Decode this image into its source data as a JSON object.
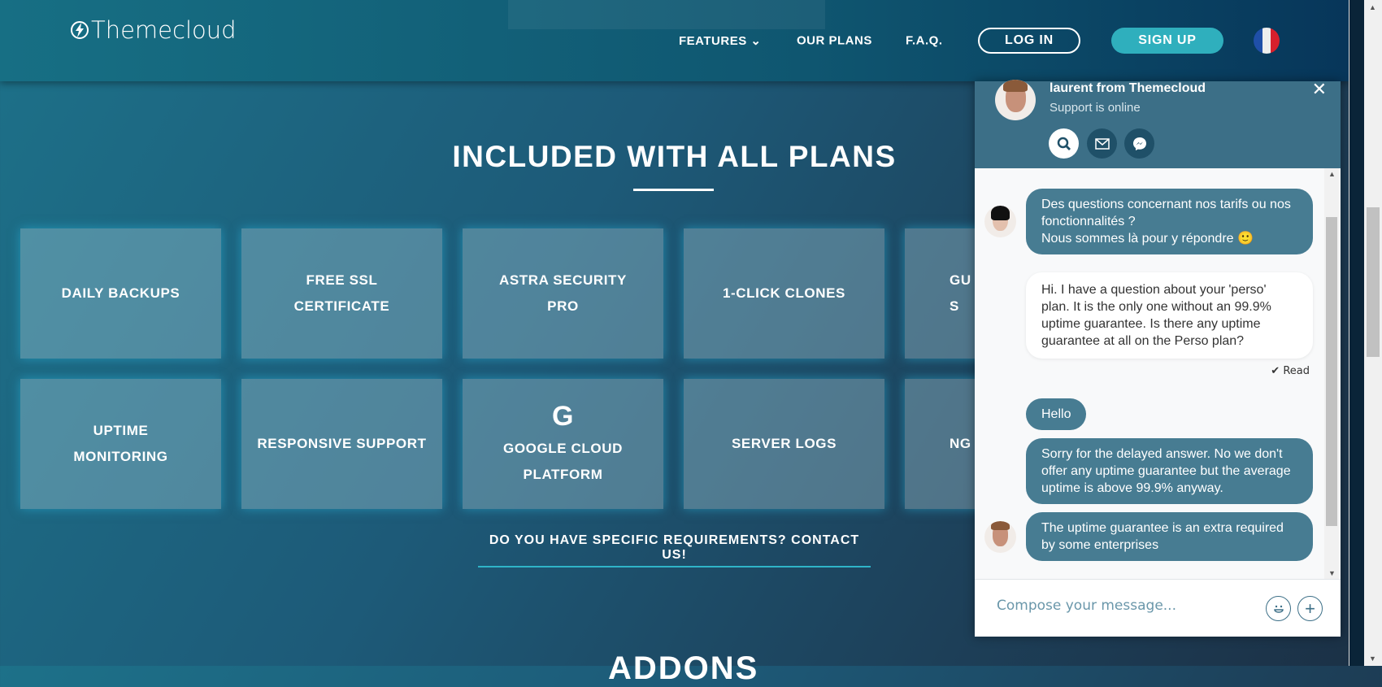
{
  "header": {
    "logo": "Themecloud",
    "nav": [
      {
        "label": "FEATURES",
        "has_dropdown": true
      },
      {
        "label": "OUR PLANS"
      },
      {
        "label": "F.A.Q."
      }
    ],
    "login": "LOG IN",
    "signup": "SIGN UP",
    "language": "fr-flag-icon"
  },
  "section": {
    "title": "INCLUDED WITH ALL PLANS",
    "tiles": [
      [
        "DAILY BACKUPS"
      ],
      [
        "FREE SSL",
        "CERTIFICATE"
      ],
      [
        "ASTRA SECURITY",
        "PRO"
      ],
      [
        "1-CLICK CLONES"
      ],
      [
        "GU",
        "S"
      ],
      [
        "UPTIME",
        "MONITORING"
      ],
      [
        "RESPONSIVE SUPPORT"
      ],
      [
        "GOOGLE CLOUD",
        "PLATFORM"
      ],
      [
        "SERVER LOGS"
      ],
      [
        "NG"
      ]
    ],
    "google_icon": "G",
    "contact": "DO YOU HAVE SPECIFIC REQUIREMENTS? CONTACT US!"
  },
  "next_section": {
    "title": "ADDONS"
  },
  "chat": {
    "agent": "laurent from Themecloud",
    "status": "Support is online",
    "messages": [
      {
        "from": "operator",
        "text": "Des questions concernant nos tarifs ou nos fonctionnalités ?\nNous sommes là pour y répondre 🙂"
      },
      {
        "from": "user",
        "text": "Hi. I have a question about your 'perso' plan. It is the only one without an 99.9% uptime guarantee. Is there any uptime guarantee at all on the Perso plan?"
      },
      {
        "from": "operator",
        "text": "Hello"
      },
      {
        "from": "operator",
        "text": "Sorry for the delayed answer. No we don't offer any uptime guarantee but the average uptime is above 99.9% anyway."
      },
      {
        "from": "operator",
        "text": "The uptime guarantee is an extra required by some enterprises"
      }
    ],
    "read": "Read",
    "placeholder": "Compose your message..."
  },
  "colors": {
    "accent": "#2fafbd",
    "chat_header": "#3c6f87",
    "bubble": "#477c92"
  }
}
